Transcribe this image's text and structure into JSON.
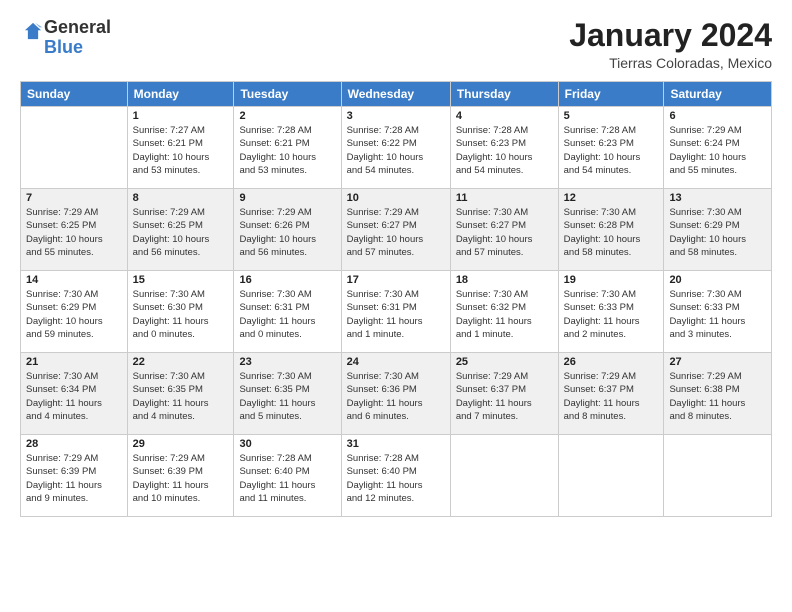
{
  "logo": {
    "general": "General",
    "blue": "Blue"
  },
  "title": "January 2024",
  "subtitle": "Tierras Coloradas, Mexico",
  "days_of_week": [
    "Sunday",
    "Monday",
    "Tuesday",
    "Wednesday",
    "Thursday",
    "Friday",
    "Saturday"
  ],
  "weeks": [
    [
      {
        "day": "",
        "info": ""
      },
      {
        "day": "1",
        "info": "Sunrise: 7:27 AM\nSunset: 6:21 PM\nDaylight: 10 hours\nand 53 minutes."
      },
      {
        "day": "2",
        "info": "Sunrise: 7:28 AM\nSunset: 6:21 PM\nDaylight: 10 hours\nand 53 minutes."
      },
      {
        "day": "3",
        "info": "Sunrise: 7:28 AM\nSunset: 6:22 PM\nDaylight: 10 hours\nand 54 minutes."
      },
      {
        "day": "4",
        "info": "Sunrise: 7:28 AM\nSunset: 6:23 PM\nDaylight: 10 hours\nand 54 minutes."
      },
      {
        "day": "5",
        "info": "Sunrise: 7:28 AM\nSunset: 6:23 PM\nDaylight: 10 hours\nand 54 minutes."
      },
      {
        "day": "6",
        "info": "Sunrise: 7:29 AM\nSunset: 6:24 PM\nDaylight: 10 hours\nand 55 minutes."
      }
    ],
    [
      {
        "day": "7",
        "info": "Sunrise: 7:29 AM\nSunset: 6:25 PM\nDaylight: 10 hours\nand 55 minutes."
      },
      {
        "day": "8",
        "info": "Sunrise: 7:29 AM\nSunset: 6:25 PM\nDaylight: 10 hours\nand 56 minutes."
      },
      {
        "day": "9",
        "info": "Sunrise: 7:29 AM\nSunset: 6:26 PM\nDaylight: 10 hours\nand 56 minutes."
      },
      {
        "day": "10",
        "info": "Sunrise: 7:29 AM\nSunset: 6:27 PM\nDaylight: 10 hours\nand 57 minutes."
      },
      {
        "day": "11",
        "info": "Sunrise: 7:30 AM\nSunset: 6:27 PM\nDaylight: 10 hours\nand 57 minutes."
      },
      {
        "day": "12",
        "info": "Sunrise: 7:30 AM\nSunset: 6:28 PM\nDaylight: 10 hours\nand 58 minutes."
      },
      {
        "day": "13",
        "info": "Sunrise: 7:30 AM\nSunset: 6:29 PM\nDaylight: 10 hours\nand 58 minutes."
      }
    ],
    [
      {
        "day": "14",
        "info": "Sunrise: 7:30 AM\nSunset: 6:29 PM\nDaylight: 10 hours\nand 59 minutes."
      },
      {
        "day": "15",
        "info": "Sunrise: 7:30 AM\nSunset: 6:30 PM\nDaylight: 11 hours\nand 0 minutes."
      },
      {
        "day": "16",
        "info": "Sunrise: 7:30 AM\nSunset: 6:31 PM\nDaylight: 11 hours\nand 0 minutes."
      },
      {
        "day": "17",
        "info": "Sunrise: 7:30 AM\nSunset: 6:31 PM\nDaylight: 11 hours\nand 1 minute."
      },
      {
        "day": "18",
        "info": "Sunrise: 7:30 AM\nSunset: 6:32 PM\nDaylight: 11 hours\nand 1 minute."
      },
      {
        "day": "19",
        "info": "Sunrise: 7:30 AM\nSunset: 6:33 PM\nDaylight: 11 hours\nand 2 minutes."
      },
      {
        "day": "20",
        "info": "Sunrise: 7:30 AM\nSunset: 6:33 PM\nDaylight: 11 hours\nand 3 minutes."
      }
    ],
    [
      {
        "day": "21",
        "info": "Sunrise: 7:30 AM\nSunset: 6:34 PM\nDaylight: 11 hours\nand 4 minutes."
      },
      {
        "day": "22",
        "info": "Sunrise: 7:30 AM\nSunset: 6:35 PM\nDaylight: 11 hours\nand 4 minutes."
      },
      {
        "day": "23",
        "info": "Sunrise: 7:30 AM\nSunset: 6:35 PM\nDaylight: 11 hours\nand 5 minutes."
      },
      {
        "day": "24",
        "info": "Sunrise: 7:30 AM\nSunset: 6:36 PM\nDaylight: 11 hours\nand 6 minutes."
      },
      {
        "day": "25",
        "info": "Sunrise: 7:29 AM\nSunset: 6:37 PM\nDaylight: 11 hours\nand 7 minutes."
      },
      {
        "day": "26",
        "info": "Sunrise: 7:29 AM\nSunset: 6:37 PM\nDaylight: 11 hours\nand 8 minutes."
      },
      {
        "day": "27",
        "info": "Sunrise: 7:29 AM\nSunset: 6:38 PM\nDaylight: 11 hours\nand 8 minutes."
      }
    ],
    [
      {
        "day": "28",
        "info": "Sunrise: 7:29 AM\nSunset: 6:39 PM\nDaylight: 11 hours\nand 9 minutes."
      },
      {
        "day": "29",
        "info": "Sunrise: 7:29 AM\nSunset: 6:39 PM\nDaylight: 11 hours\nand 10 minutes."
      },
      {
        "day": "30",
        "info": "Sunrise: 7:28 AM\nSunset: 6:40 PM\nDaylight: 11 hours\nand 11 minutes."
      },
      {
        "day": "31",
        "info": "Sunrise: 7:28 AM\nSunset: 6:40 PM\nDaylight: 11 hours\nand 12 minutes."
      },
      {
        "day": "",
        "info": ""
      },
      {
        "day": "",
        "info": ""
      },
      {
        "day": "",
        "info": ""
      }
    ]
  ]
}
